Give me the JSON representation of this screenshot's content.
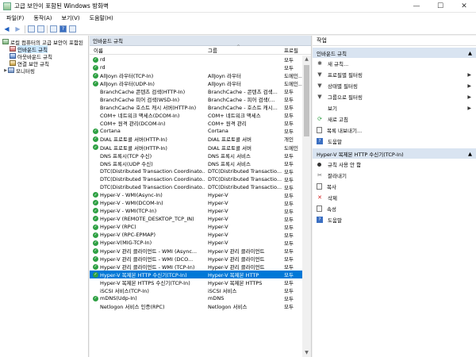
{
  "window": {
    "title": "고급 보안이 포함된 Windows 방화벽",
    "min": "—",
    "max": "☐",
    "close": "✕"
  },
  "menu": [
    "파일(F)",
    "동작(A)",
    "보기(V)",
    "도움말(H)"
  ],
  "tree": {
    "root": "로컬 컴퓨터의 고급 보안이 포함된",
    "items": [
      "인바운드 규칙",
      "아웃바운드 규칙",
      "연결 보안 규칙",
      "모니터링"
    ]
  },
  "main": {
    "header": "인바운드 규칙",
    "columns": {
      "name": "이름",
      "group": "그룹",
      "profile": "프로필"
    },
    "rows": [
      {
        "enabled": true,
        "name": "rd",
        "group": "",
        "profile": "모두"
      },
      {
        "enabled": true,
        "name": "rd",
        "group": "",
        "profile": "모두"
      },
      {
        "enabled": true,
        "name": "AllJoyn 라우터(TCP-In)",
        "group": "AllJoyn 라우터",
        "profile": "도메인..."
      },
      {
        "enabled": true,
        "name": "AllJoyn 라우터(UDP-In)",
        "group": "AllJoyn 라우터",
        "profile": "도메인..."
      },
      {
        "enabled": false,
        "name": "BranchCache 콘텐츠 검색(HTTP-In)",
        "group": "BranchCache - 콘텐츠 검색...",
        "profile": "모두"
      },
      {
        "enabled": false,
        "name": "BranchCache 피어 검색(WSD-In)",
        "group": "BranchCache - 피어 검색(...",
        "profile": "모두"
      },
      {
        "enabled": false,
        "name": "BranchCache 호스트 캐시 서버(HTTP-In)",
        "group": "BranchCache - 호스트 캐시...",
        "profile": "모두"
      },
      {
        "enabled": false,
        "name": "COM+ 네트워크 액세스(DCOM-In)",
        "group": "COM+ 네트워크 액세스",
        "profile": "모두"
      },
      {
        "enabled": false,
        "name": "COM+ 원격 관리(DCOM-In)",
        "group": "COM+ 원격 관리",
        "profile": "모두"
      },
      {
        "enabled": true,
        "name": "Cortana",
        "group": "Cortana",
        "profile": "모두"
      },
      {
        "enabled": true,
        "name": "DIAL 프로토콜 서버(HTTP-In)",
        "group": "DIAL 프로토콜 서버",
        "profile": "개인"
      },
      {
        "enabled": true,
        "name": "DIAL 프로토콜 서버(HTTP-In)",
        "group": "DIAL 프로토콜 서버",
        "profile": "도메인"
      },
      {
        "enabled": false,
        "name": "DNS 프록시(TCP 수신)",
        "group": "DNS 프록시 서비스",
        "profile": "모두"
      },
      {
        "enabled": false,
        "name": "DNS 프록시(UDP 수신)",
        "group": "DNS 프록시 서비스",
        "profile": "모두"
      },
      {
        "enabled": false,
        "name": "DTC(Distributed Transaction Coordinato...",
        "group": "DTC(Distributed Transactio...",
        "profile": "모두"
      },
      {
        "enabled": false,
        "name": "DTC(Distributed Transaction Coordinato...",
        "group": "DTC(Distributed Transactio...",
        "profile": "모두"
      },
      {
        "enabled": false,
        "name": "DTC(Distributed Transaction Coordinato...",
        "group": "DTC(Distributed Transactio...",
        "profile": "모두"
      },
      {
        "enabled": true,
        "name": "Hyper-V - WMI(Async-In)",
        "group": "Hyper-V",
        "profile": "모두"
      },
      {
        "enabled": true,
        "name": "Hyper-V - WMI(DCOM-In)",
        "group": "Hyper-V",
        "profile": "모두"
      },
      {
        "enabled": true,
        "name": "Hyper-V - WMI(TCP-In)",
        "group": "Hyper-V",
        "profile": "모두"
      },
      {
        "enabled": true,
        "name": "Hyper-V (REMOTE_DESKTOP_TCP_IN)",
        "group": "Hyper-V",
        "profile": "모두"
      },
      {
        "enabled": true,
        "name": "Hyper-V (RPC)",
        "group": "Hyper-V",
        "profile": "모두"
      },
      {
        "enabled": true,
        "name": "Hyper-V (RPC-EPMAP)",
        "group": "Hyper-V",
        "profile": "모두"
      },
      {
        "enabled": true,
        "name": "Hyper-V(MIG-TCP-In)",
        "group": "Hyper-V",
        "profile": "모두"
      },
      {
        "enabled": true,
        "name": "Hyper-V 관리 클라이언트 - WMI (Async...",
        "group": "Hyper-V 관리 클라이언트",
        "profile": "모두"
      },
      {
        "enabled": true,
        "name": "Hyper-V 관리 클라이언트 - WMI (DCO...",
        "group": "Hyper-V 관리 클라이언트",
        "profile": "모두"
      },
      {
        "enabled": true,
        "name": "Hyper-V 관리 클라이언트 - WMI (TCP-In)",
        "group": "Hyper-V 관리 클라이언트",
        "profile": "모두"
      },
      {
        "enabled": true,
        "name": "Hyper-V 복제본 HTTP 수신기(TCP-In)",
        "group": "Hyper-V 복제본 HTTP",
        "profile": "모두",
        "selected": true
      },
      {
        "enabled": false,
        "name": "Hyper-V 복제본 HTTPS 수신기(TCP-In)",
        "group": "Hyper-V 복제본 HTTPS",
        "profile": "모두"
      },
      {
        "enabled": false,
        "name": "iSCSI 서비스(TCP-In)",
        "group": "iSCSI 서비스",
        "profile": "모두"
      },
      {
        "enabled": true,
        "name": "mDNS(Udp-In)",
        "group": "mDNS",
        "profile": "모두"
      },
      {
        "enabled": false,
        "name": "Netlogon 서비스 인증(RPC)",
        "group": "Netlogon 서비스",
        "profile": "모두"
      }
    ]
  },
  "actions": {
    "header": "작업",
    "section1": {
      "title": "인바운드 규칙",
      "items": [
        {
          "label": "새 규칙...",
          "icon": "new-rule-icon",
          "submenu": false
        },
        {
          "label": "프로필별 필터링",
          "icon": "filter-icon",
          "submenu": true
        },
        {
          "label": "상태별 필터링",
          "icon": "filter-icon",
          "submenu": true
        },
        {
          "label": "그룹으로 필터링",
          "icon": "filter-icon",
          "submenu": true
        },
        {
          "label": "보기",
          "icon": "",
          "submenu": true
        },
        {
          "label": "새로 고침",
          "icon": "refresh-icon",
          "submenu": false
        },
        {
          "label": "목록 내보내기...",
          "icon": "export-icon",
          "submenu": false
        },
        {
          "label": "도움말",
          "icon": "help-icon",
          "submenu": false
        }
      ]
    },
    "section2": {
      "title": "Hyper-V 복제본 HTTP 수신기(TCP-In)",
      "items": [
        {
          "label": "규칙 사용 안 함",
          "icon": "disable-icon"
        },
        {
          "label": "잘라내기",
          "icon": "cut-icon"
        },
        {
          "label": "복사",
          "icon": "copy-icon"
        },
        {
          "label": "삭제",
          "icon": "delete-icon"
        },
        {
          "label": "속성",
          "icon": "properties-icon"
        },
        {
          "label": "도움말",
          "icon": "help-icon"
        }
      ]
    }
  }
}
